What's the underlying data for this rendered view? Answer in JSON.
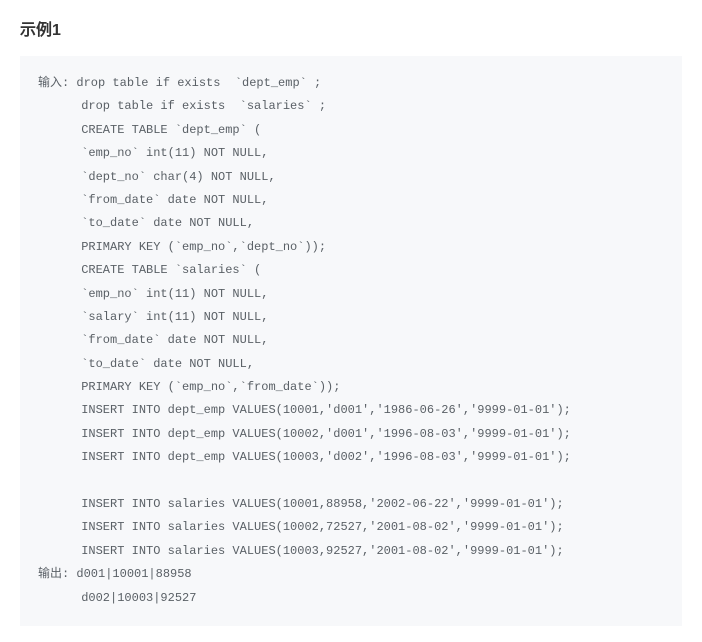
{
  "title": "示例1",
  "input_label": "输入:",
  "output_label": "输出:",
  "input_lines": [
    "drop table if exists  `dept_emp` ;",
    "drop table if exists  `salaries` ;",
    "CREATE TABLE `dept_emp` (",
    "`emp_no` int(11) NOT NULL,",
    "`dept_no` char(4) NOT NULL,",
    "`from_date` date NOT NULL,",
    "`to_date` date NOT NULL,",
    "PRIMARY KEY (`emp_no`,`dept_no`));",
    "CREATE TABLE `salaries` (",
    "`emp_no` int(11) NOT NULL,",
    "`salary` int(11) NOT NULL,",
    "`from_date` date NOT NULL,",
    "`to_date` date NOT NULL,",
    "PRIMARY KEY (`emp_no`,`from_date`));",
    "INSERT INTO dept_emp VALUES(10001,'d001','1986-06-26','9999-01-01');",
    "INSERT INTO dept_emp VALUES(10002,'d001','1996-08-03','9999-01-01');",
    "INSERT INTO dept_emp VALUES(10003,'d002','1996-08-03','9999-01-01');",
    "",
    "INSERT INTO salaries VALUES(10001,88958,'2002-06-22','9999-01-01');",
    "INSERT INTO salaries VALUES(10002,72527,'2001-08-02','9999-01-01');",
    "INSERT INTO salaries VALUES(10003,92527,'2001-08-02','9999-01-01');"
  ],
  "output_lines": [
    "d001|10001|88958",
    "d002|10003|92527"
  ]
}
